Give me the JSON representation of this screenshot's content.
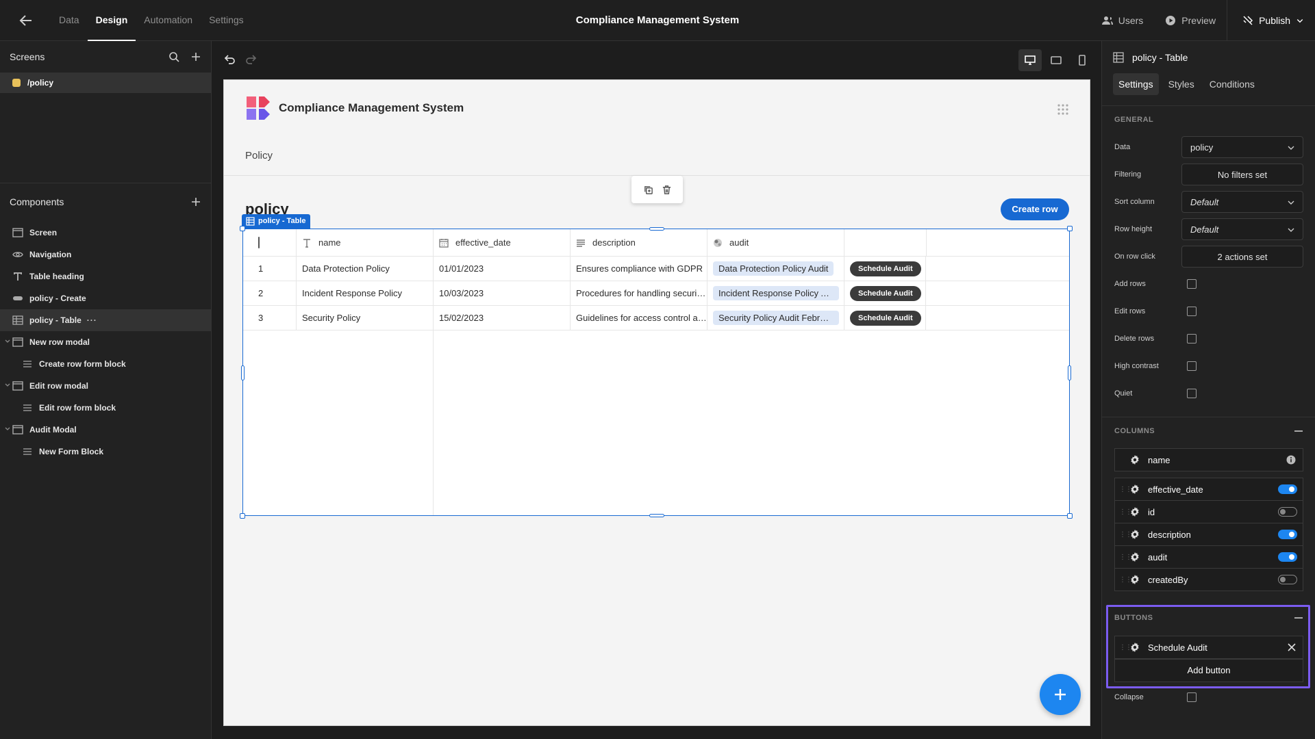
{
  "topbar": {
    "nav": [
      "Data",
      "Design",
      "Automation",
      "Settings"
    ],
    "active_nav": "Design",
    "app_title": "Compliance Management System",
    "users": "Users",
    "preview": "Preview",
    "publish": "Publish"
  },
  "left": {
    "screens_title": "Screens",
    "screen_route": "/policy",
    "components_title": "Components",
    "components": [
      {
        "label": "Screen",
        "icon": "screen-icon"
      },
      {
        "label": "Navigation",
        "icon": "eye-icon"
      },
      {
        "label": "Table heading",
        "icon": "text-icon"
      },
      {
        "label": "policy - Create",
        "icon": "button-icon"
      },
      {
        "label": "policy - Table",
        "icon": "table-icon"
      },
      {
        "label": "New row modal",
        "icon": "modal-icon"
      },
      {
        "label": "Create row form block",
        "icon": "form-icon"
      },
      {
        "label": "Edit row modal",
        "icon": "modal-icon"
      },
      {
        "label": "Edit row form block",
        "icon": "form-icon"
      },
      {
        "label": "Audit Modal",
        "icon": "modal-icon"
      },
      {
        "label": "New Form Block",
        "icon": "form-icon"
      }
    ]
  },
  "canvas": {
    "app_name": "Compliance Management System",
    "nav_link": "Policy",
    "heading": "policy",
    "create_row": "Create row",
    "table_tag": "policy - Table",
    "columns": [
      "name",
      "effective_date",
      "description",
      "audit"
    ],
    "rows": [
      {
        "num": "1",
        "name": "Data Protection Policy",
        "date": "01/01/2023",
        "desc": "Ensures compliance with GDPR",
        "audit": "Data Protection Policy Audit",
        "btn": "Schedule Audit"
      },
      {
        "num": "2",
        "name": "Incident Response Policy",
        "date": "10/03/2023",
        "desc": "Procedures for handling security incidents",
        "audit": "Incident Response Policy Audit",
        "btn": "Schedule Audit"
      },
      {
        "num": "3",
        "name": "Security Policy",
        "date": "15/02/2023",
        "desc": "Guidelines for access control and security",
        "audit": "Security Policy Audit February",
        "btn": "Schedule Audit"
      }
    ],
    "accent": "#1769d2"
  },
  "right": {
    "title": "policy - Table",
    "tabs": [
      "Settings",
      "Styles",
      "Conditions"
    ],
    "general_label": "GENERAL",
    "data_label": "Data",
    "data_value": "policy",
    "filtering_label": "Filtering",
    "filtering_value": "No filters set",
    "sort_label": "Sort column",
    "sort_value": "Default",
    "rowh_label": "Row height",
    "rowh_value": "Default",
    "onclick_label": "On row click",
    "onclick_value": "2 actions set",
    "checks": [
      "Add rows",
      "Edit rows",
      "Delete rows",
      "High contrast",
      "Quiet"
    ],
    "columns_label": "COLUMNS",
    "columns": [
      {
        "name": "name",
        "state": "info"
      },
      {
        "name": "effective_date",
        "state": "on"
      },
      {
        "name": "id",
        "state": "off"
      },
      {
        "name": "description",
        "state": "on"
      },
      {
        "name": "audit",
        "state": "on"
      },
      {
        "name": "createdBy",
        "state": "off"
      }
    ],
    "buttons_label": "BUTTONS",
    "button_item": "Schedule Audit",
    "add_button": "Add button",
    "collapse_label": "Collapse",
    "highlight_color": "#7b5cf0"
  }
}
